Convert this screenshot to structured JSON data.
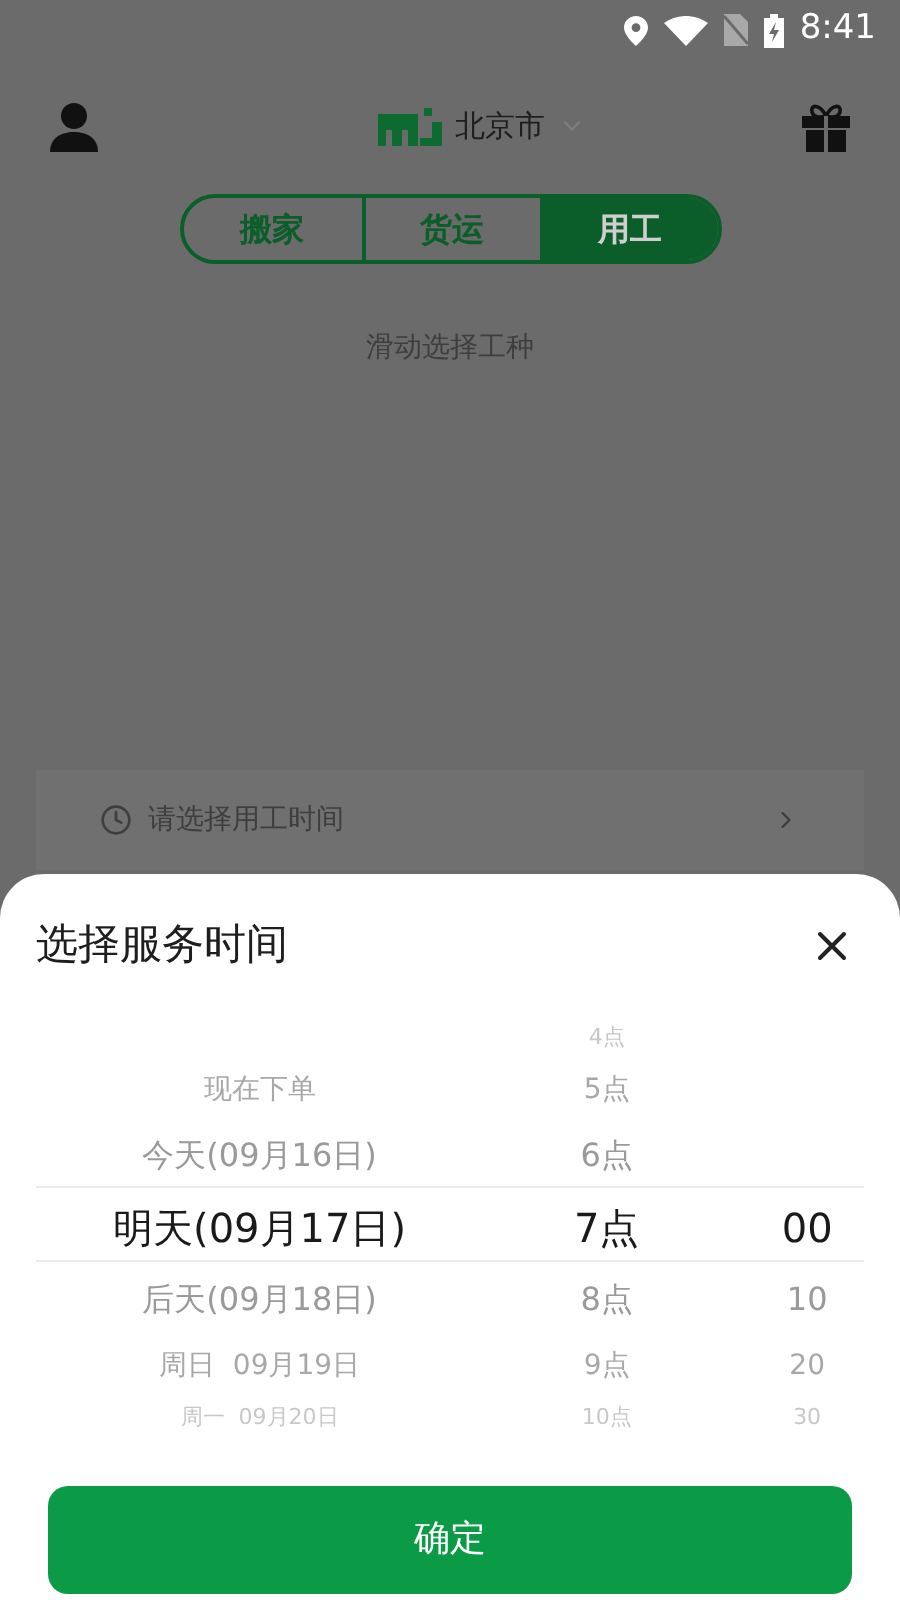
{
  "status_bar": {
    "time": "8:41"
  },
  "header": {
    "city": "北京市"
  },
  "tabs": [
    {
      "label": "搬家",
      "selected": false
    },
    {
      "label": "货运",
      "selected": false
    },
    {
      "label": "用工",
      "selected": true
    }
  ],
  "hint": "滑动选择工种",
  "time_row": {
    "placeholder": "请选择用工时间"
  },
  "sheet": {
    "title": "选择服务时间",
    "columns": [
      {
        "items": [
          {
            "label": "现在下单",
            "selected": false
          },
          {
            "label": "今天(09月16日)",
            "selected": false
          },
          {
            "label": "明天(09月17日)",
            "selected": true
          },
          {
            "label": "后天(09月18日)",
            "selected": false
          },
          {
            "label": "周日  09月19日",
            "selected": false
          },
          {
            "label": "周一  09月20日",
            "selected": false
          }
        ]
      },
      {
        "items": [
          {
            "label": "4点",
            "selected": false
          },
          {
            "label": "5点",
            "selected": false
          },
          {
            "label": "6点",
            "selected": false
          },
          {
            "label": "7点",
            "selected": true
          },
          {
            "label": "8点",
            "selected": false
          },
          {
            "label": "9点",
            "selected": false
          },
          {
            "label": "10点",
            "selected": false
          }
        ]
      },
      {
        "items": [
          {
            "label": "00",
            "selected": true
          },
          {
            "label": "10",
            "selected": false
          },
          {
            "label": "20",
            "selected": false
          },
          {
            "label": "30",
            "selected": false
          }
        ]
      }
    ],
    "confirm": "确定"
  }
}
